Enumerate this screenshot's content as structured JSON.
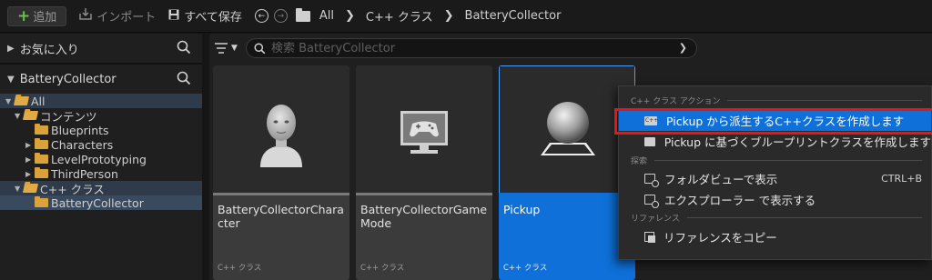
{
  "toolbar": {
    "add_label": "追加",
    "import_label": "インポート",
    "save_all_label": "すべて保存",
    "breadcrumb": [
      "All",
      "C++ クラス",
      "BatteryCollector"
    ]
  },
  "sidebar": {
    "favorites_label": "お気に入り",
    "project_label": "BatteryCollector",
    "tree": [
      {
        "label": "All"
      },
      {
        "label": "コンテンツ"
      },
      {
        "label": "Blueprints"
      },
      {
        "label": "Characters"
      },
      {
        "label": "LevelPrototyping"
      },
      {
        "label": "ThirdPerson"
      },
      {
        "label": "C++ クラス"
      },
      {
        "label": "BatteryCollector"
      }
    ]
  },
  "search": {
    "placeholder": "検索 BatteryCollector"
  },
  "assets": [
    {
      "name": "BatteryCollectorCharacter",
      "type": "C++ クラス",
      "icon": "person-icon"
    },
    {
      "name": "BatteryCollectorGame Mode",
      "type": "C++ クラス",
      "icon": "gamepad-icon"
    },
    {
      "name": "Pickup",
      "type": "C++ クラス",
      "icon": "sphere-icon"
    }
  ],
  "context_menu": {
    "section_cpp": "C++ クラス アクション",
    "create_cpp_class": "Pickup から派生するC++クラスを作成します",
    "create_blueprint_class": "Pickup に基づくブループリントクラスを作成します",
    "section_explore": "探索",
    "show_in_folder_view": "フォルダビューで表示",
    "show_in_folder_view_shortcut": "CTRL+B",
    "show_in_explorer": "エクスプローラー で表示する",
    "section_reference": "リファレンス",
    "copy_reference": "リファレンスをコピー"
  },
  "colors": {
    "accent": "#0e70d8",
    "highlight_outline": "#e8141b",
    "folder": "#d9a23a"
  }
}
